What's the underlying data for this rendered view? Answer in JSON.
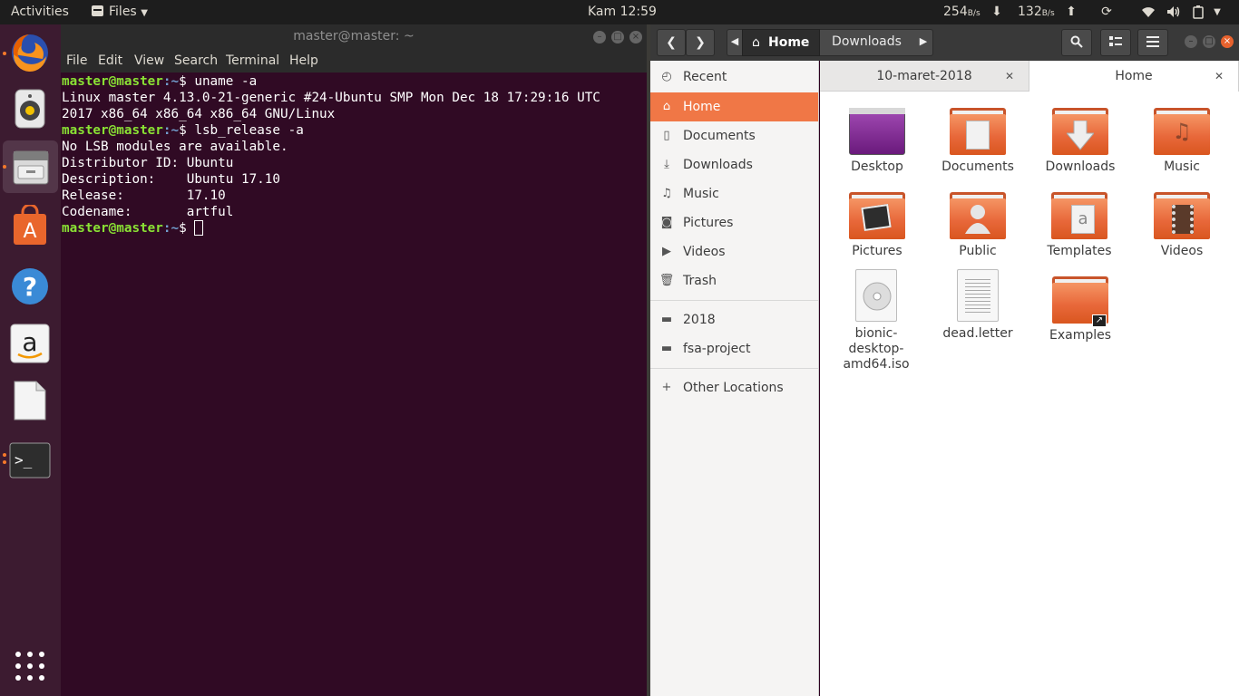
{
  "topbar": {
    "activities": "Activities",
    "app_menu": "Files",
    "clock": "Kam 12:59",
    "net_down": "254",
    "net_down_unit": "B/s",
    "net_up": "132",
    "net_up_unit": "B/s"
  },
  "dock": {
    "items": [
      "firefox",
      "rhythmbox",
      "files",
      "ubuntu-software",
      "help",
      "amazon",
      "libreoffice-writer",
      "terminal"
    ]
  },
  "terminal": {
    "title": "master@master: ~",
    "menu": [
      "File",
      "Edit",
      "View",
      "Search",
      "Terminal",
      "Help"
    ],
    "prompt_user": "master@master",
    "prompt_path": ":~",
    "prompt_sign": "$ ",
    "cmd1": "uname -a",
    "out1a": "Linux master 4.13.0-21-generic #24-Ubuntu SMP Mon Dec 18 17:29:16 UTC",
    "out1b": "2017 x86_64 x86_64 x86_64 GNU/Linux",
    "cmd2": "lsb_release -a",
    "out2a": "No LSB modules are available.",
    "out2b": "Distributor ID: Ubuntu",
    "out2c": "Description:    Ubuntu 17.10",
    "out2d": "Release:        17.10",
    "out2e": "Codename:       artful"
  },
  "files": {
    "path": {
      "home": "Home",
      "downloads": "Downloads"
    },
    "sidebar": {
      "recent": "Recent",
      "home": "Home",
      "documents": "Documents",
      "downloads": "Downloads",
      "music": "Music",
      "pictures": "Pictures",
      "videos": "Videos",
      "trash": "Trash",
      "bm1": "2018",
      "bm2": "fsa-project",
      "other": "Other Locations"
    },
    "tabs": {
      "tab1": "10-maret-2018",
      "tab2": "Home"
    },
    "items": {
      "desktop": "Desktop",
      "documents": "Documents",
      "downloads": "Downloads",
      "music": "Music",
      "pictures": "Pictures",
      "public": "Public",
      "templates": "Templates",
      "videos": "Videos",
      "iso_line1": "bionic-",
      "iso_line2": "desktop-",
      "iso_line3": "amd64.iso",
      "deadletter": "dead.letter",
      "examples": "Examples"
    }
  },
  "colors": {
    "accent": "#f07746",
    "terminal_bg": "#300a24",
    "prompt_user": "#8ae234",
    "prompt_path": "#729fcf"
  }
}
